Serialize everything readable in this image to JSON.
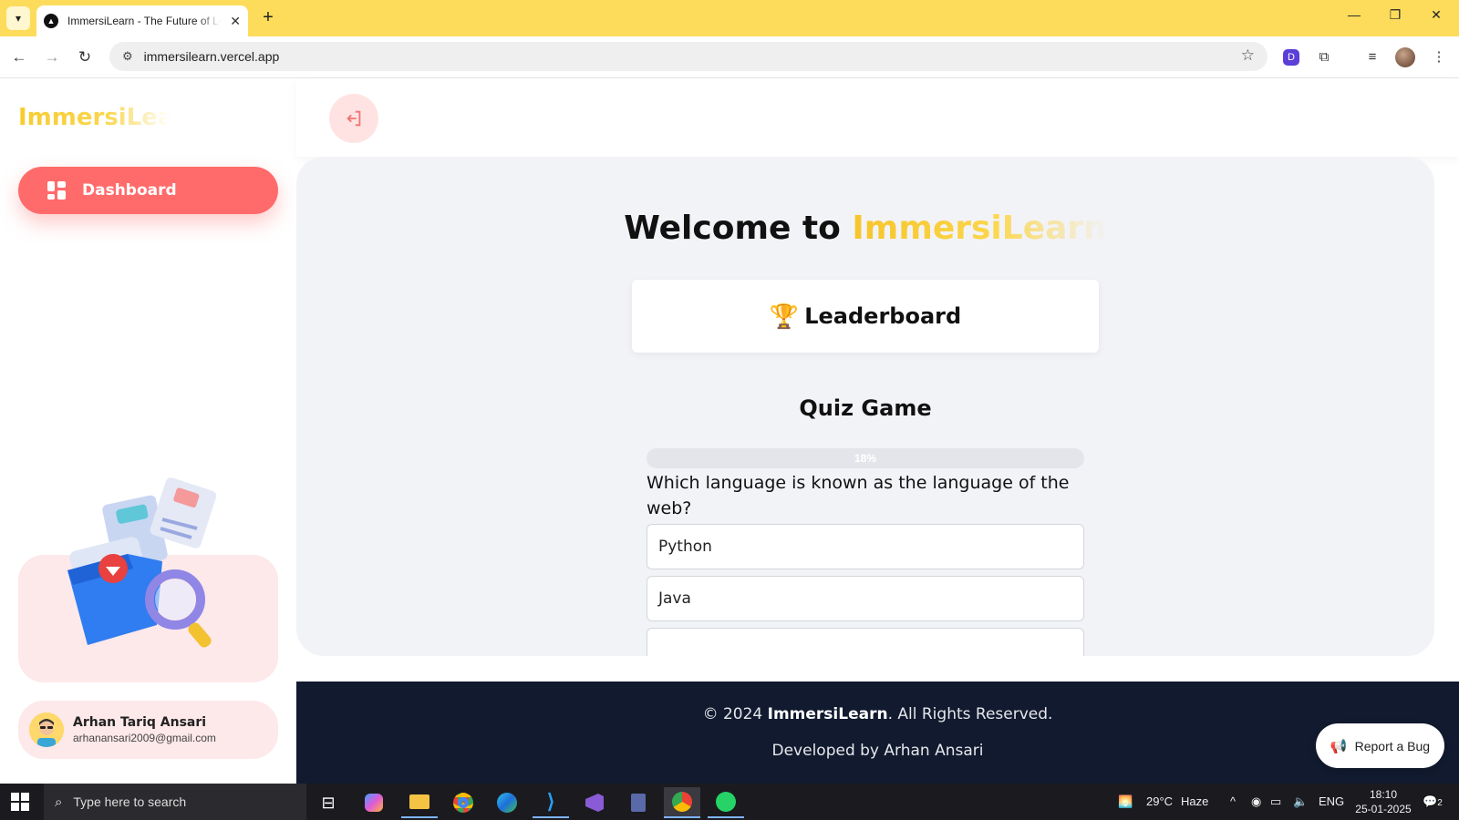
{
  "browser": {
    "tab_title": "ImmersiLearn - The Future of Learning",
    "url": "immersilearn.vercel.app"
  },
  "sidebar": {
    "logo": "ImmersiLearn",
    "nav_items": [
      {
        "label": "Dashboard"
      }
    ],
    "user": {
      "name": "Arhan Tariq Ansari",
      "email": "arhanansari2009@gmail.com"
    }
  },
  "main": {
    "welcome_prefix": "Welcome to",
    "welcome_brand": "ImmersiLearn",
    "leaderboard_title": "Leaderboard",
    "quiz": {
      "title": "Quiz Game",
      "progress_label": "18%",
      "progress_value": 18,
      "question": "Which language is known as the language of the web?",
      "options": [
        "Python",
        "Java"
      ]
    }
  },
  "footer": {
    "copyright_prefix": "© 2024",
    "copyright_brand": "ImmersiLearn",
    "copyright_suffix": ". All Rights Reserved.",
    "developed_by": "Developed by Arhan Ansari",
    "report_bug": "Report a Bug"
  },
  "taskbar": {
    "search_placeholder": "Type here to search",
    "weather": "29°C",
    "weather_desc": "Haze",
    "language": "ENG",
    "time": "18:10",
    "date": "25-01-2025",
    "notifications": "2"
  },
  "colors": {
    "accent": "#ff6b6b",
    "brand_yellow": "#f7cc2e",
    "tab_bar": "#fddc5c",
    "footer_bg": "#111a2e"
  }
}
